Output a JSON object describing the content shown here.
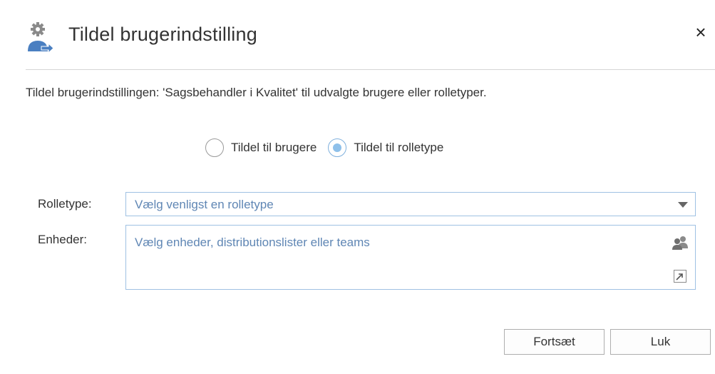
{
  "dialog": {
    "title": "Tildel brugerindstilling",
    "icon": "user-settings-icon",
    "close_label": "×",
    "description": "Tildel brugerindstillingen: 'Sagsbehandler i Kvalitet' til udvalgte brugere eller rolletyper."
  },
  "assign_mode": {
    "options": [
      {
        "label": "Tildel til brugere",
        "checked": false
      },
      {
        "label": "Tildel til rolletype",
        "checked": true
      }
    ]
  },
  "form": {
    "role_type": {
      "label": "Rolletype:",
      "placeholder": "Vælg venligst en rolletype"
    },
    "units": {
      "label": "Enheder:",
      "placeholder": "Vælg enheder, distributionslister eller teams"
    }
  },
  "buttons": {
    "continue_label": "Fortsæt",
    "close_label": "Luk"
  },
  "colors": {
    "accent": "#8ec0ea",
    "field_border": "#9fc1e3",
    "placeholder_text": "#5f86b4",
    "icon_gray": "#8a8a8a",
    "icon_blue": "#4a7fc1"
  }
}
